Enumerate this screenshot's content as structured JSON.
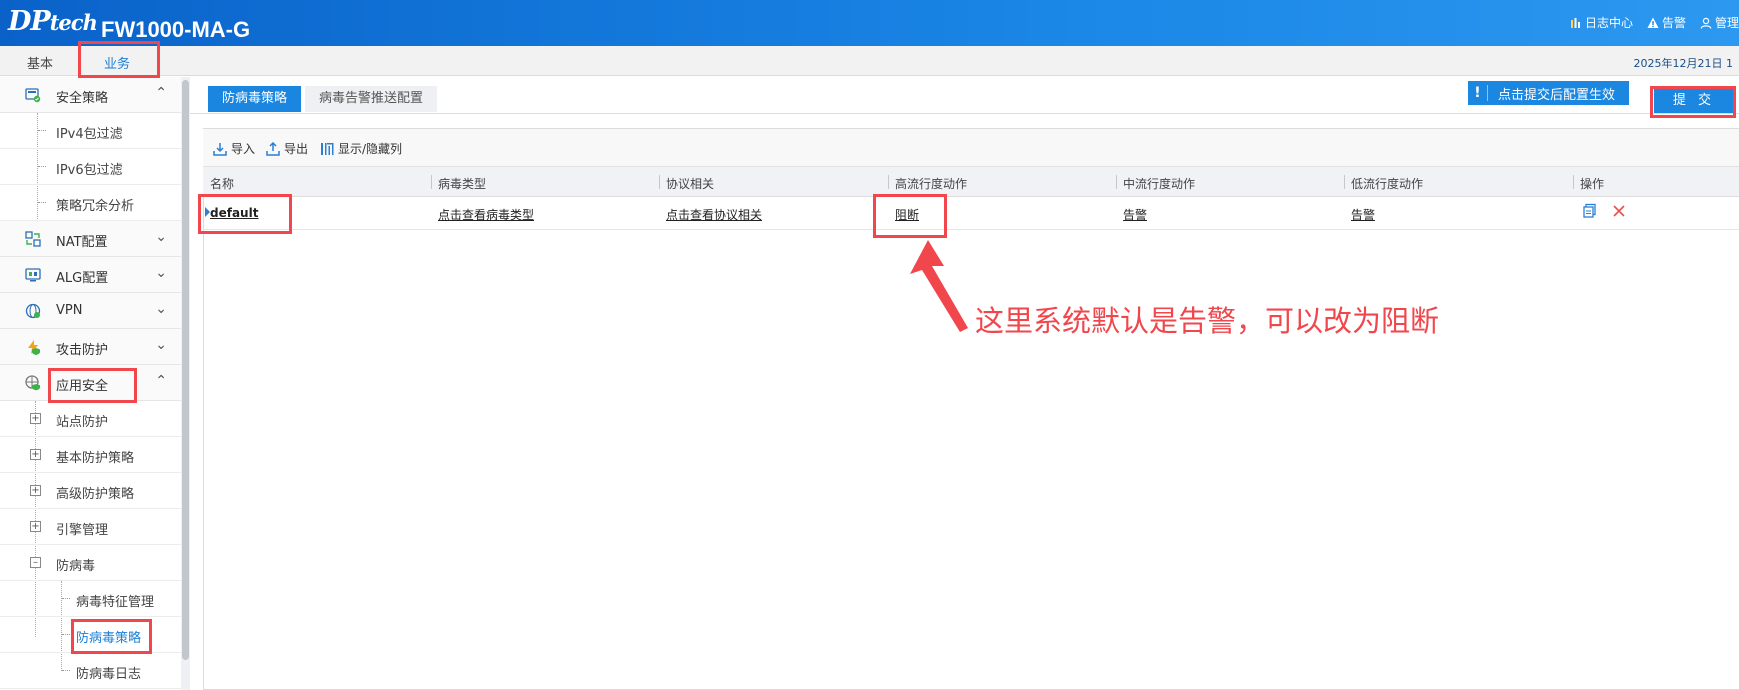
{
  "header": {
    "logo_main": "DP",
    "logo_sub": "tech",
    "model": "FW1000-MA-G",
    "links": [
      {
        "label": "日志中心",
        "icon": "bar-chart-icon"
      },
      {
        "label": "告警",
        "icon": "warning-icon"
      },
      {
        "label": "管理",
        "icon": "user-icon"
      }
    ]
  },
  "menubar": {
    "tabs": [
      {
        "label": "基本"
      },
      {
        "label": "业务",
        "active": true
      }
    ],
    "datetime": "2025年12月21日 1"
  },
  "sidebar": {
    "categories": [
      {
        "label": "安全策略",
        "icon": "security-policy-icon",
        "expanded": true,
        "items": [
          "IPv4包过滤",
          "IPv6包过滤",
          "策略冗余分析"
        ]
      },
      {
        "label": "NAT配置",
        "icon": "nat-icon",
        "expanded": false
      },
      {
        "label": "ALG配置",
        "icon": "alg-icon",
        "expanded": false
      },
      {
        "label": "VPN",
        "icon": "vpn-icon",
        "expanded": false
      },
      {
        "label": "攻击防护",
        "icon": "attack-defense-icon",
        "expanded": false
      },
      {
        "label": "应用安全",
        "icon": "app-security-icon",
        "expanded": true,
        "tree": [
          {
            "label": "站点防护",
            "toggle": "+"
          },
          {
            "label": "基本防护策略",
            "toggle": "+"
          },
          {
            "label": "高级防护策略",
            "toggle": "+"
          },
          {
            "label": "引擎管理",
            "toggle": "+"
          },
          {
            "label": "防病毒",
            "toggle": "-",
            "children": [
              "病毒特征管理",
              "防病毒策略",
              "防病毒日志"
            ]
          }
        ]
      }
    ],
    "active_item": "防病毒策略"
  },
  "main": {
    "tabs": [
      {
        "label": "防病毒策略",
        "active": true
      },
      {
        "label": "病毒告警推送配置"
      }
    ],
    "notice": {
      "icon_text": "!",
      "text": "点击提交后配置生效"
    },
    "submit_label": "提 交",
    "toolbar": [
      {
        "label": "导入",
        "icon": "import-icon"
      },
      {
        "label": "导出",
        "icon": "export-icon"
      },
      {
        "label": "显示/隐藏列",
        "icon": "columns-icon"
      }
    ],
    "table": {
      "columns": [
        "名称",
        "病毒类型",
        "协议相关",
        "高流行度动作",
        "中流行度动作",
        "低流行度动作",
        "操作"
      ],
      "rows": [
        {
          "name": "default",
          "virus_type": "点击查看病毒类型",
          "protocol": "点击查看协议相关",
          "high": "阻断",
          "mid": "告警",
          "low": "告警"
        }
      ]
    }
  },
  "annotation": {
    "text": "这里系统默认是告警，可以改为阻断",
    "color": "#f0464c"
  }
}
